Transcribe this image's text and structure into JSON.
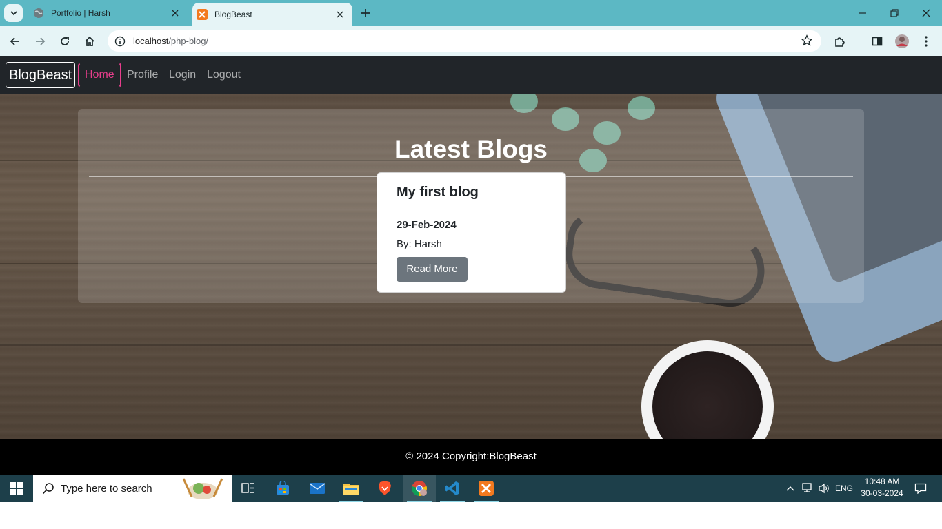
{
  "browser": {
    "tabs": [
      {
        "title": "Portfolio | Harsh",
        "active": false
      },
      {
        "title": "BlogBeast",
        "active": true
      }
    ],
    "url_host": "localhost",
    "url_path": "/php-blog/"
  },
  "site": {
    "brand": "BlogBeast",
    "nav": [
      "Home",
      "Profile",
      "Login",
      "Logout"
    ],
    "active_nav": "Home",
    "heading": "Latest Blogs",
    "posts": [
      {
        "title": "My first blog",
        "date": "29-Feb-2024",
        "author": "By: Harsh",
        "button": "Read More"
      }
    ],
    "footer": "© 2024 Copyright:BlogBeast"
  },
  "taskbar": {
    "search_placeholder": "Type here to search",
    "language": "ENG",
    "time": "10:48 AM",
    "date": "30-03-2024"
  },
  "colors": {
    "tab_strip": "#5cb8c4",
    "toolbar": "#e6f4f6",
    "navbar": "#212529",
    "active_nav": "#e83e8c",
    "button": "#6c757d",
    "footer": "#000000",
    "taskbar": "#1d3f4a"
  }
}
